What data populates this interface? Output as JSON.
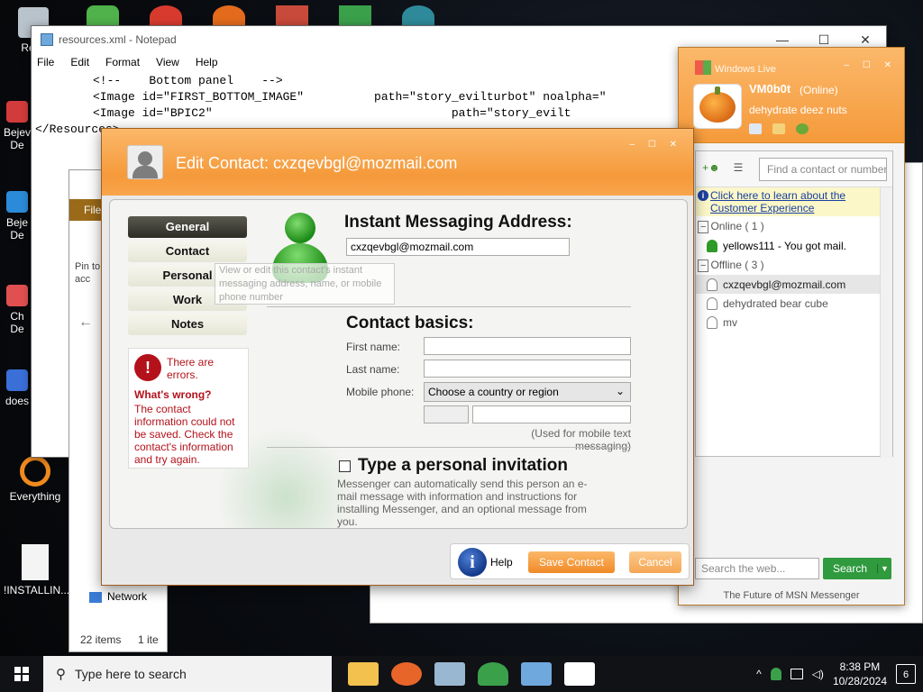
{
  "desktop": {
    "icons": [
      {
        "label": "Recy"
      },
      {
        "label": "Bejev\nDe"
      },
      {
        "label": "Beje\nDe"
      },
      {
        "label": "Ch\nDe"
      },
      {
        "label": "does"
      },
      {
        "label": "Everything"
      },
      {
        "label": "!INSTALLIN..."
      }
    ]
  },
  "notepad": {
    "title": "resources.xml - Notepad",
    "menu": [
      "File",
      "Edit",
      "Format",
      "View",
      "Help"
    ],
    "lines": [
      "<!--    Bottom panel    -->",
      "<Image id=\"FIRST_BOTTOM_IMAGE\"          path=\"story_evilturbot\" noalpha=\"",
      "<Image id=\"BPIC2\"                                  path=\"story_evilt",
      "</Resources>"
    ],
    "controls": {
      "minimize": "—",
      "maximize": "☐",
      "close": "✕"
    }
  },
  "explorer": {
    "file_tab": "File",
    "pin_label": "Pin to\nacc",
    "back": "←",
    "network": "Network",
    "item_count": "22 items",
    "selection": "1 ite"
  },
  "messenger": {
    "brand": "Windows Live",
    "user_name": "VM0b0t",
    "user_status": "(Online)",
    "personal_message": "dehydrate deez nuts",
    "find_placeholder": "Find a contact or number",
    "notice_link": "Click here to learn about the Customer Experience",
    "groups": [
      {
        "name": "Online ( 1 )",
        "contacts": [
          {
            "name": "yellows111 - You got mail.",
            "status": "online"
          }
        ]
      },
      {
        "name": "Offline ( 3 )",
        "contacts": [
          {
            "name": "cxzqevbgl@mozmail.com",
            "status": "offline",
            "selected": true
          },
          {
            "name": "dehydrated bear cube",
            "status": "offline"
          },
          {
            "name": "mv",
            "status": "offline"
          }
        ]
      }
    ],
    "web_search_placeholder": "Search the web...",
    "search_button": "Search",
    "footer": "The Future of MSN Messenger"
  },
  "dialog": {
    "title": "Edit Contact: cxzqevbgl@mozmail.com",
    "tabs": [
      {
        "label": "General",
        "active": true
      },
      {
        "label": "Contact",
        "active": false
      },
      {
        "label": "Personal",
        "active": false
      },
      {
        "label": "Work",
        "active": false
      },
      {
        "label": "Notes",
        "active": false
      }
    ],
    "tooltip": "View or edit this contact's instant messaging address, name, or mobile phone number",
    "error": {
      "heading": "There are errors.",
      "what": "What's wrong?",
      "text": "The contact information could not be saved. Check the contact's information and try again."
    },
    "im_heading": "Instant Messaging Address:",
    "im_value": "cxzqevbgl@mozmail.com",
    "basics_heading": "Contact basics:",
    "first_name_label": "First name:",
    "last_name_label": "Last name:",
    "mobile_label": "Mobile phone:",
    "country_select": "Choose a country or region",
    "mobile_hint": "(Used for mobile text messaging)",
    "invite_heading": "Type a personal invitation",
    "invite_text": "Messenger can automatically send this person an e-mail message with information and instructions for installing Messenger, and an optional message from you.",
    "help_label": "Help",
    "save_label": "Save Contact",
    "cancel_label": "Cancel"
  },
  "taskbar": {
    "search_placeholder": "Type here to search",
    "time": "8:38 PM",
    "date": "10/28/2024",
    "notifications": "6"
  }
}
